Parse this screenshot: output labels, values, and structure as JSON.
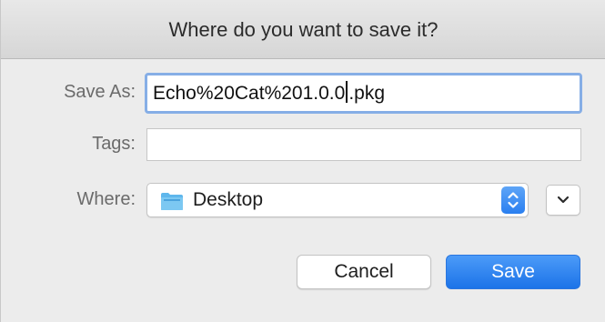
{
  "dialog": {
    "title": "Where do you want to save it?"
  },
  "fields": {
    "save_as_label": "Save As:",
    "save_as_before_caret": "Echo%20Cat%201.0.0",
    "save_as_after_caret": ".pkg",
    "tags_label": "Tags:",
    "tags_value": "",
    "where_label": "Where:",
    "where_value": "Desktop"
  },
  "buttons": {
    "cancel": "Cancel",
    "save": "Save"
  },
  "icons": {
    "folder": "folder-icon",
    "stepper": "up-down-chevron-icon",
    "expand": "chevron-down-icon"
  },
  "colors": {
    "accent": "#1c73e8",
    "focus_ring": "#86aee6",
    "folder": "#5fb7ec"
  }
}
